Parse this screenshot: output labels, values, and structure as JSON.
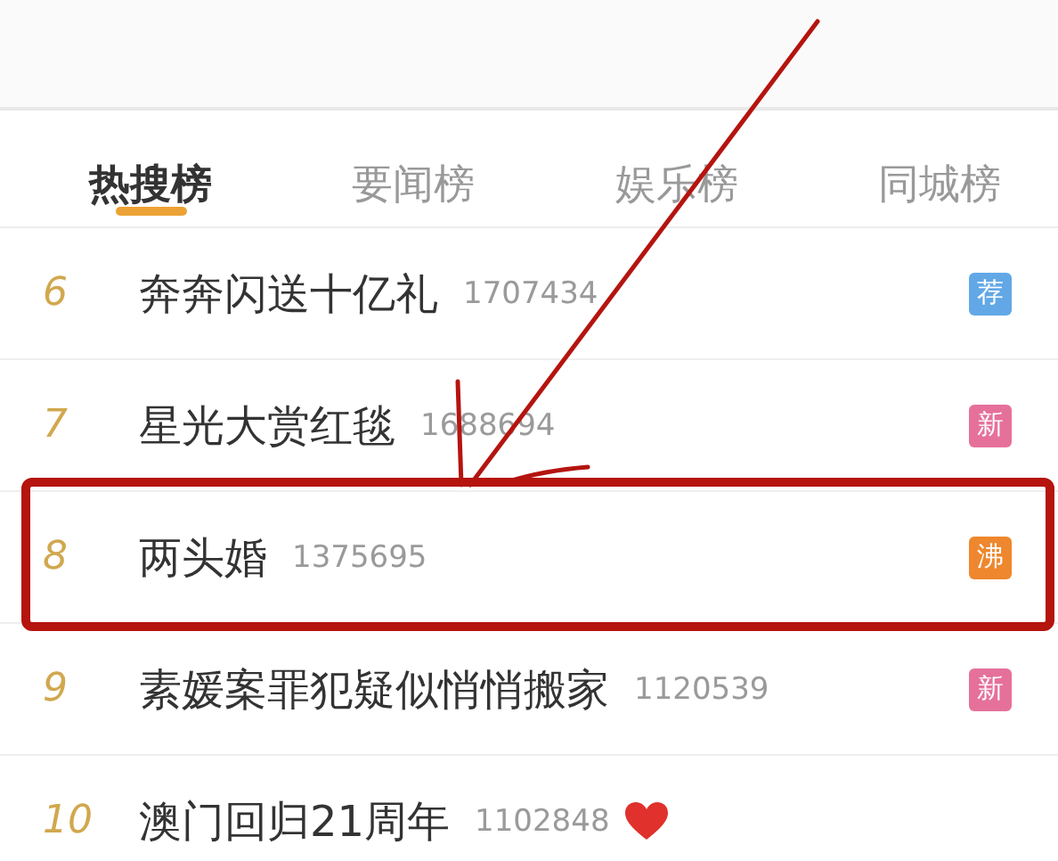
{
  "tabs": [
    {
      "label": "热搜榜",
      "selected": true
    },
    {
      "label": "要闻榜",
      "selected": false
    },
    {
      "label": "娱乐榜",
      "selected": false
    },
    {
      "label": "同城榜",
      "selected": false
    }
  ],
  "rows": [
    {
      "rank": "6",
      "title": "奔奔闪送十亿礼",
      "count": "1707434",
      "badge": {
        "text": "荐",
        "color": "#62a8e6"
      },
      "heart": false,
      "highlighted": false
    },
    {
      "rank": "7",
      "title": "星光大赏红毯",
      "count": "1688694",
      "badge": {
        "text": "新",
        "color": "#e5719b"
      },
      "heart": false,
      "highlighted": false
    },
    {
      "rank": "8",
      "title": "两头婚",
      "count": "1375695",
      "badge": {
        "text": "沸",
        "color": "#ee872d"
      },
      "heart": false,
      "highlighted": true
    },
    {
      "rank": "9",
      "title": "素媛案罪犯疑似悄悄搬家",
      "count": "1120539",
      "badge": {
        "text": "新",
        "color": "#e5719b"
      },
      "heart": false,
      "highlighted": false
    },
    {
      "rank": "10",
      "title": "澳门回归21周年",
      "count": "1102848",
      "heart": true,
      "highlighted": false
    }
  ]
}
